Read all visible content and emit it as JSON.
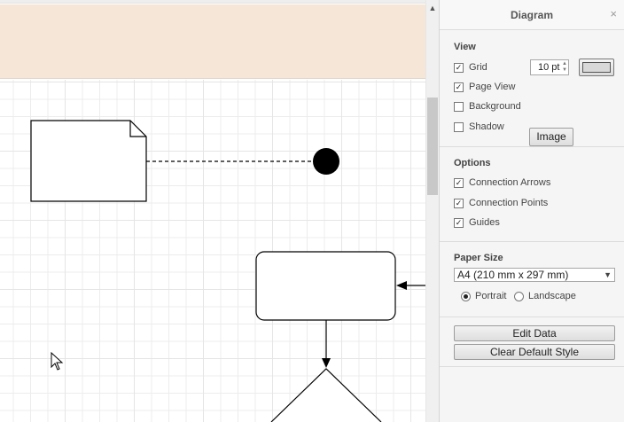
{
  "panel": {
    "title": "Diagram",
    "close_icon": "×"
  },
  "view": {
    "title": "View",
    "grid_label": "Grid",
    "grid_checked": true,
    "grid_size_value": "10 pt",
    "grid_color": "#d8d8d8",
    "page_view_label": "Page View",
    "page_view_checked": true,
    "background_label": "Background",
    "background_checked": false,
    "image_button_label": "Image",
    "shadow_label": "Shadow",
    "shadow_checked": false
  },
  "options": {
    "title": "Options",
    "connection_arrows_label": "Connection Arrows",
    "connection_arrows_checked": true,
    "connection_points_label": "Connection Points",
    "connection_points_checked": true,
    "guides_label": "Guides",
    "guides_checked": true
  },
  "paper": {
    "title": "Paper Size",
    "selected_size": "A4 (210 mm x 297 mm)",
    "portrait_label": "Portrait",
    "portrait_selected": true,
    "landscape_label": "Landscape",
    "landscape_selected": false
  },
  "actions": {
    "edit_data_label": "Edit Data",
    "clear_default_style_label": "Clear Default Style"
  },
  "colors": {
    "page_band": "#f6e6d8",
    "panel_bg": "#f5f5f5"
  },
  "icons": {
    "checkbox_checked": "check-icon",
    "select_arrow": "chevron-down-icon",
    "scroll_up": "scroll-up-arrow-icon",
    "cursor": "mouse-pointer-icon"
  }
}
